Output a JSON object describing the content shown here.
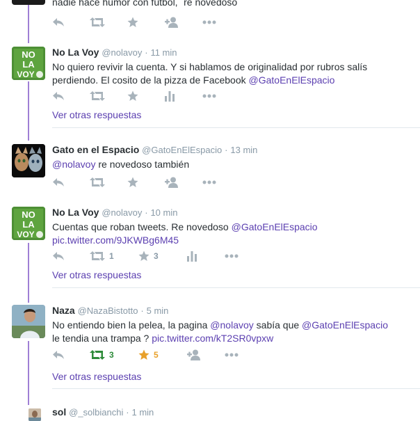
{
  "partial_tweet": {
    "text": "nadie hace humor con futbol, ´re novedoso"
  },
  "tweets": [
    {
      "name": "No La Voy",
      "handle": "@nolavoy",
      "time": "11 min",
      "text_plain": "No quiero revivir la cuenta. Y si hablamos de originalidad por rubros salís perdiendo. El cosito de la pizza de Facebook ",
      "mention": "@GatoEnElEspacio",
      "more": "Ver otras respuestas"
    },
    {
      "name": "Gato en el Espacio",
      "handle": "@GatoEnElEspacio",
      "time": "13 min",
      "mention": "@nolavoy",
      "text_plain": " re novedoso también"
    },
    {
      "name": "No La Voy",
      "handle": "@nolavoy",
      "time": "10 min",
      "text_plain": "Cuentas que roban tweets. Re novedoso ",
      "mention": "@GatoEnElEspacio",
      "pic": "pic.twitter.com/9JKWBg6M45",
      "retweets": "1",
      "favorites": "3",
      "more": "Ver otras respuestas"
    },
    {
      "name": "Naza",
      "handle": "@NazaBistotto",
      "time": "5 min",
      "text_a": "No entiendo bien la pelea, la pagina ",
      "mention1": "@nolavoy",
      "text_b": " sabía que ",
      "mention2": "@GatoEnElEspacio",
      "text_c": "le tendia una trampa ? ",
      "pic": "pic.twitter.com/kT2SR0vpxw",
      "retweets": "3",
      "favorites": "5",
      "more": "Ver otras respuestas"
    },
    {
      "name": "sol",
      "handle": "@_solbianchi",
      "time": "1 min"
    }
  ],
  "avatar_text": {
    "nolavoy": [
      "NO",
      "LA",
      "VOY"
    ]
  },
  "separator": "·",
  "colors": {
    "link": "#5b3fb0",
    "thread": "#9f7fd5",
    "retweet": "#2e8b3a",
    "favorite": "#e8a02a",
    "icon": "#a8b3bb"
  }
}
